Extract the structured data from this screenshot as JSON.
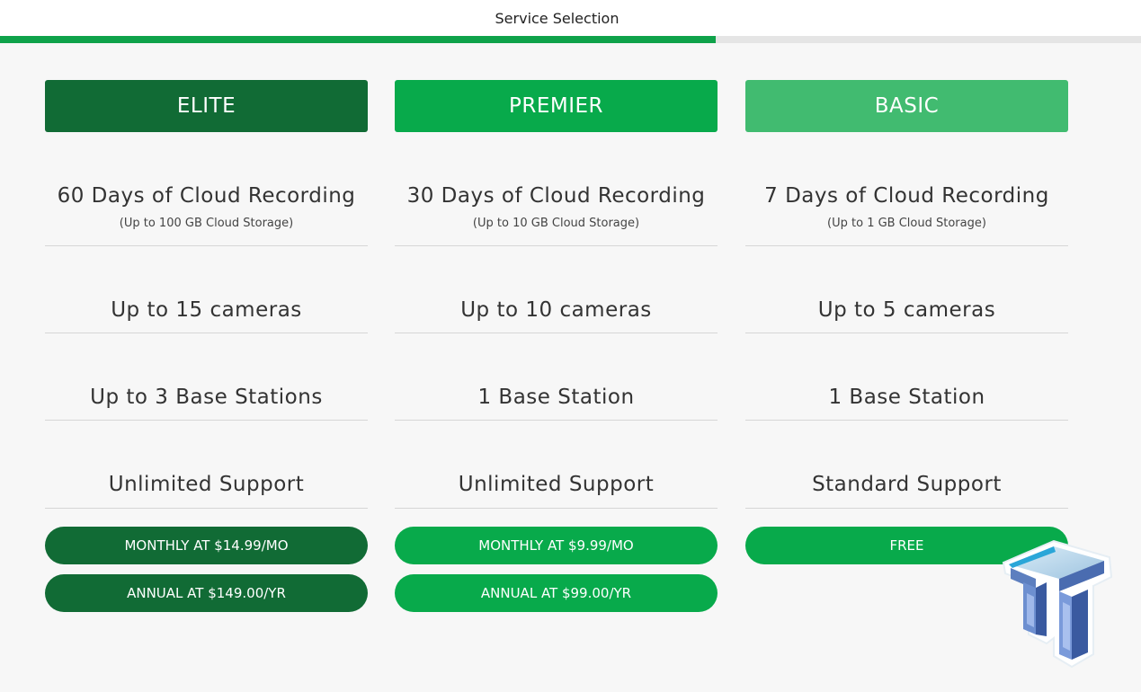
{
  "header": {
    "title": "Service Selection",
    "progress_fraction": 0.627
  },
  "colors": {
    "elite": "#116b35",
    "premier": "#08aa4b",
    "basic": "#41bb70",
    "progress": "#0fa24a"
  },
  "plans": [
    {
      "name": "ELITE",
      "recording": "60 Days of Cloud Recording",
      "storage": "(Up to 100 GB Cloud Storage)",
      "cameras": "Up to 15 cameras",
      "base_stations": "Up to 3 Base Stations",
      "support": "Unlimited Support",
      "buttons": [
        "MONTHLY AT $14.99/MO",
        "ANNUAL AT $149.00/YR"
      ]
    },
    {
      "name": "PREMIER",
      "recording": "30 Days of Cloud Recording",
      "storage": "(Up to 10 GB Cloud Storage)",
      "cameras": "Up to 10 cameras",
      "base_stations": "1 Base Station",
      "support": "Unlimited Support",
      "buttons": [
        "MONTHLY AT $9.99/MO",
        "ANNUAL AT $99.00/YR"
      ]
    },
    {
      "name": "BASIC",
      "recording": "7 Days of Cloud Recording",
      "storage": "(Up to 1 GB Cloud Storage)",
      "cameras": "Up to 5 cameras",
      "base_stations": "1 Base Station",
      "support": "Standard Support",
      "buttons": [
        "FREE"
      ]
    }
  ],
  "watermark": {
    "icon": "tt-logo-icon"
  }
}
